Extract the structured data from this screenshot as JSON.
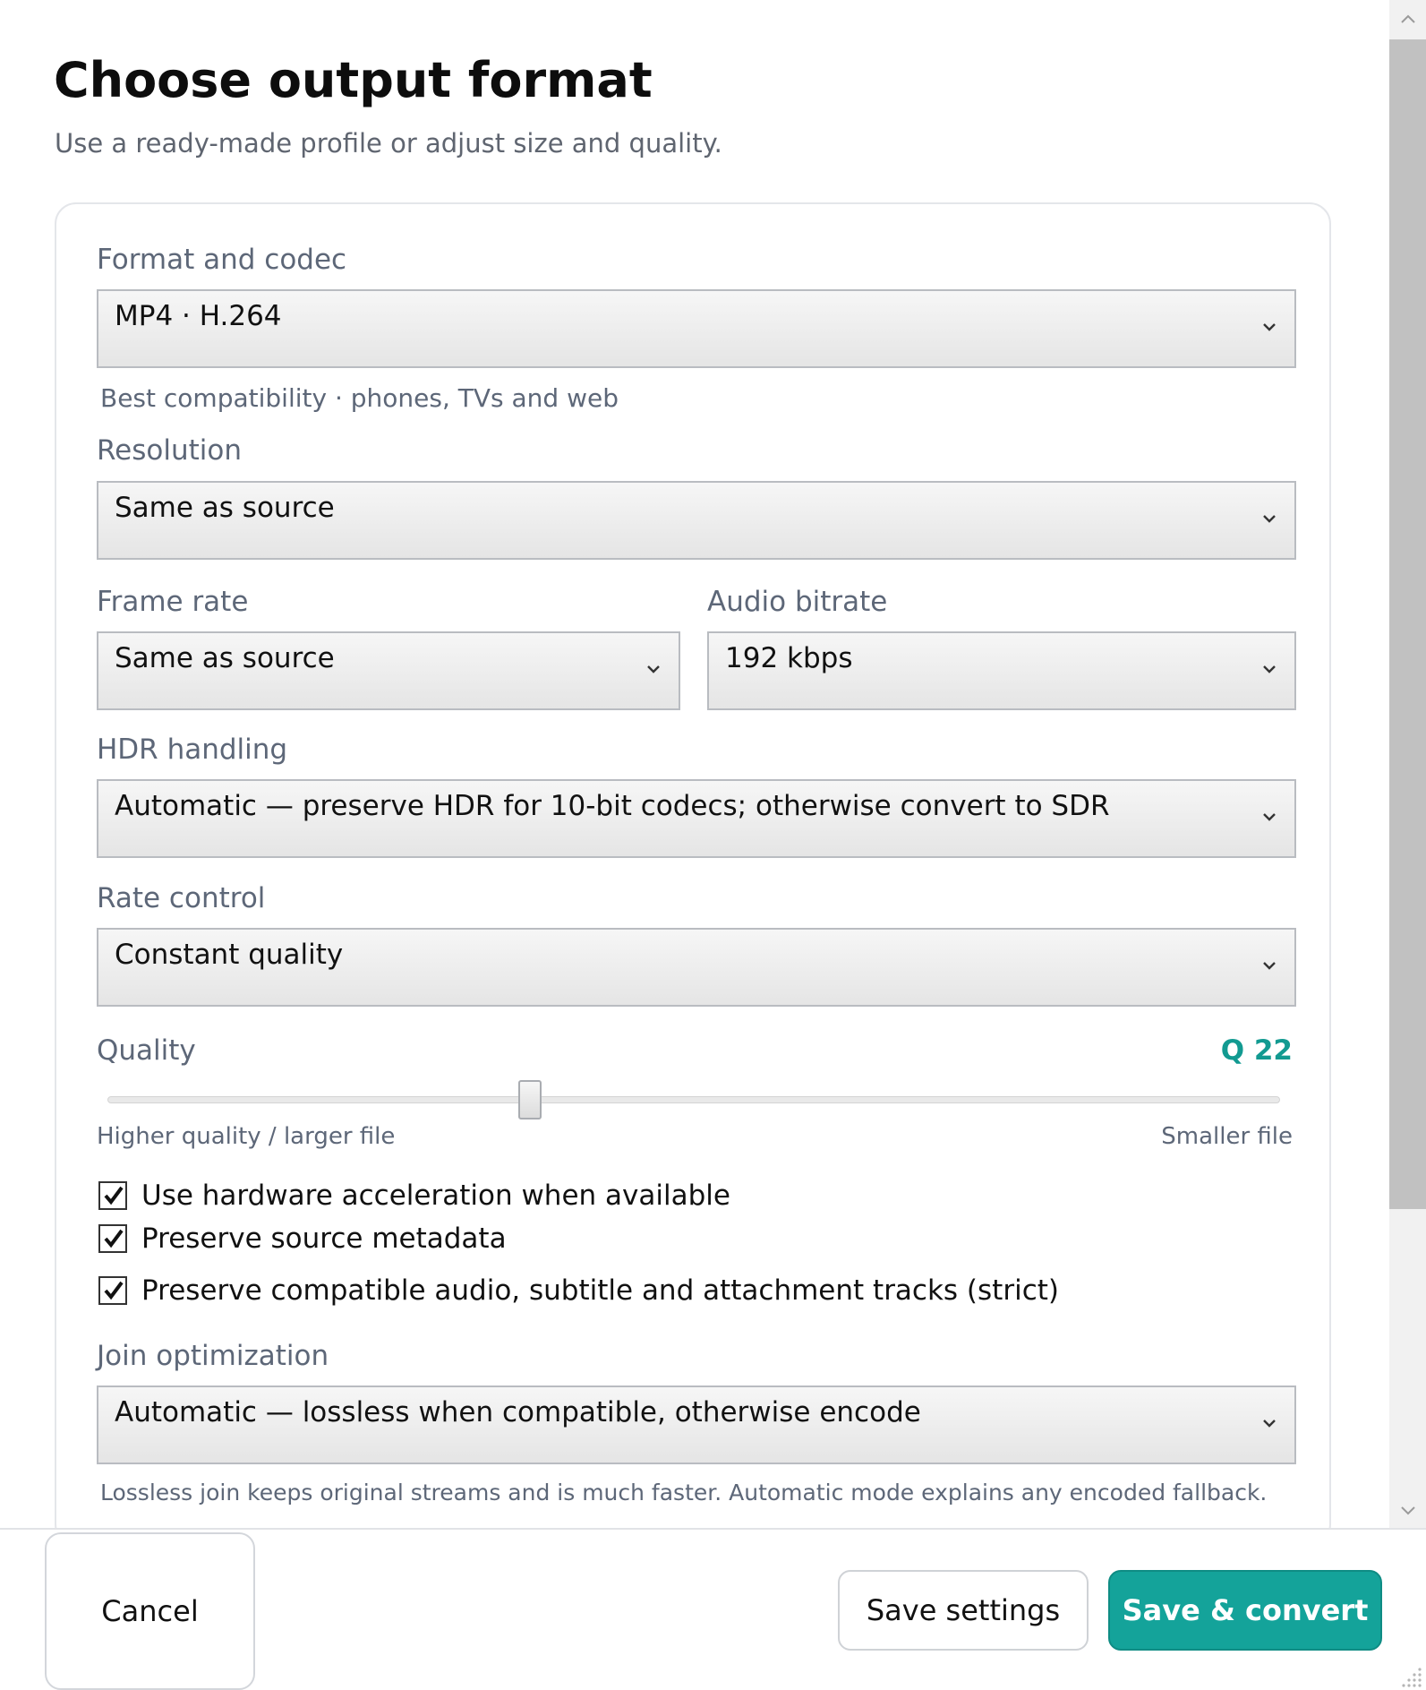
{
  "header": {
    "title": "Choose output format",
    "subtitle": "Use a ready-made profile or adjust size and quality."
  },
  "form": {
    "format": {
      "label": "Format and codec",
      "value": "MP4 · H.264",
      "helper": "Best compatibility · phones, TVs and web"
    },
    "resolution": {
      "label": "Resolution",
      "value": "Same as source"
    },
    "frame_rate": {
      "label": "Frame rate",
      "value": "Same as source"
    },
    "audio_bitrate": {
      "label": "Audio bitrate",
      "value": "192 kbps"
    },
    "hdr": {
      "label": "HDR handling",
      "value": "Automatic — preserve HDR for 10-bit codecs; otherwise convert to SDR"
    },
    "rate_control": {
      "label": "Rate control",
      "value": "Constant quality"
    },
    "quality": {
      "label": "Quality",
      "value_text": "Q 22",
      "slider_fraction": 0.36,
      "left_hint": "Higher quality / larger file",
      "right_hint": "Smaller file"
    },
    "checkboxes": [
      {
        "label": "Use hardware acceleration when available",
        "checked": true
      },
      {
        "label": "Preserve source metadata",
        "checked": true
      },
      {
        "label": "Preserve compatible audio, subtitle and attachment tracks (strict)",
        "checked": true
      }
    ],
    "join": {
      "label": "Join optimization",
      "value": "Automatic — lossless when compatible, otherwise encode",
      "helper": "Lossless join keeps original streams and is much faster. Automatic mode explains any encoded fallback."
    }
  },
  "footer": {
    "cancel": "Cancel",
    "save_settings": "Save settings",
    "save_convert": "Save & convert"
  },
  "colors": {
    "accent": "#14a39a",
    "label": "#5d6778"
  },
  "icons": {
    "select": "chevron-down-icon",
    "check": "checkmark-icon",
    "scroll_up": "chevron-up-icon",
    "scroll_down": "chevron-down-icon",
    "resize": "resize-grip-icon"
  }
}
